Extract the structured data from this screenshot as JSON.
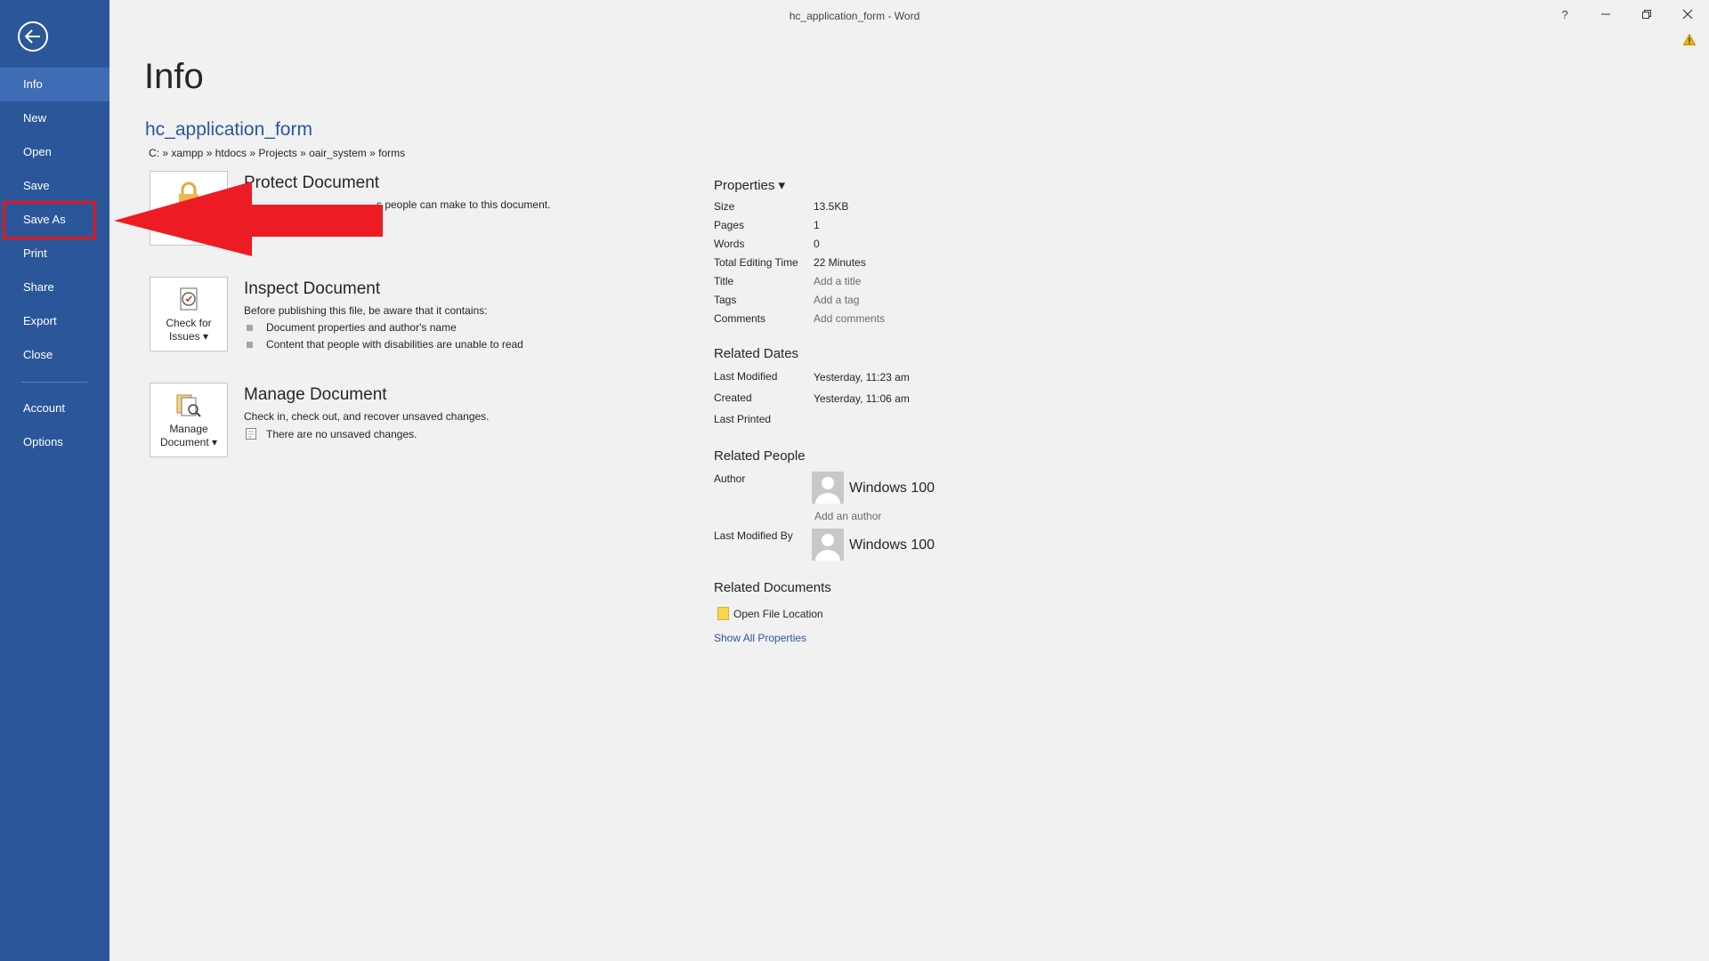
{
  "window": {
    "title": "hc_application_form - Word",
    "help_label": "?",
    "minimize_label": "–",
    "close_label": "✕"
  },
  "sidebar": {
    "items": [
      {
        "label": "Info"
      },
      {
        "label": "New"
      },
      {
        "label": "Open"
      },
      {
        "label": "Save"
      },
      {
        "label": "Save As"
      },
      {
        "label": "Print"
      },
      {
        "label": "Share"
      },
      {
        "label": "Export"
      },
      {
        "label": "Close"
      },
      {
        "label": "Account"
      },
      {
        "label": "Options"
      }
    ],
    "active_item": "Info",
    "highlighted_item": "Save As",
    "sidebar_color": "#2b579a",
    "highlight_color": "#e4161a"
  },
  "main": {
    "page_title": "Info",
    "doc_name": "hc_application_form",
    "doc_path": "C: » xampp » htdocs » Projects » oair_system » forms",
    "protect": {
      "title": "Protect Document",
      "desc_fragment": "s people can make to this document."
    },
    "inspect": {
      "tile_label_1": "Check for",
      "tile_label_2": "Issues ▾",
      "title": "Inspect Document",
      "desc": "Before publishing this file, be aware that it contains:",
      "bullets": [
        "Document properties and author's name",
        "Content that people with disabilities are unable to read"
      ]
    },
    "manage": {
      "tile_label_1": "Manage",
      "tile_label_2": "Document ▾",
      "title": "Manage Document",
      "desc": "Check in, check out, and recover unsaved changes.",
      "note": "There are no unsaved changes."
    }
  },
  "properties": {
    "heading": "Properties ▾",
    "rows": [
      {
        "label": "Size",
        "value": "13.5KB"
      },
      {
        "label": "Pages",
        "value": "1"
      },
      {
        "label": "Words",
        "value": "0"
      },
      {
        "label": "Total Editing Time",
        "value": "22 Minutes"
      },
      {
        "label": "Title",
        "value": "Add a title"
      },
      {
        "label": "Tags",
        "value": "Add a tag"
      },
      {
        "label": "Comments",
        "value": "Add comments"
      }
    ],
    "dates_heading": "Related Dates",
    "dates": [
      {
        "label": "Last Modified",
        "value": "Yesterday, 11:23 am"
      },
      {
        "label": "Created",
        "value": "Yesterday, 11:06 am"
      },
      {
        "label": "Last Printed",
        "value": ""
      }
    ],
    "people_heading": "Related People",
    "author_label": "Author",
    "author_name": "Windows 100",
    "add_author": "Add an author",
    "last_modified_by_label": "Last Modified By",
    "last_modified_by_name": "Windows 100",
    "docs_heading": "Related Documents",
    "open_file_location": "Open File Location",
    "show_all": "Show All Properties"
  }
}
